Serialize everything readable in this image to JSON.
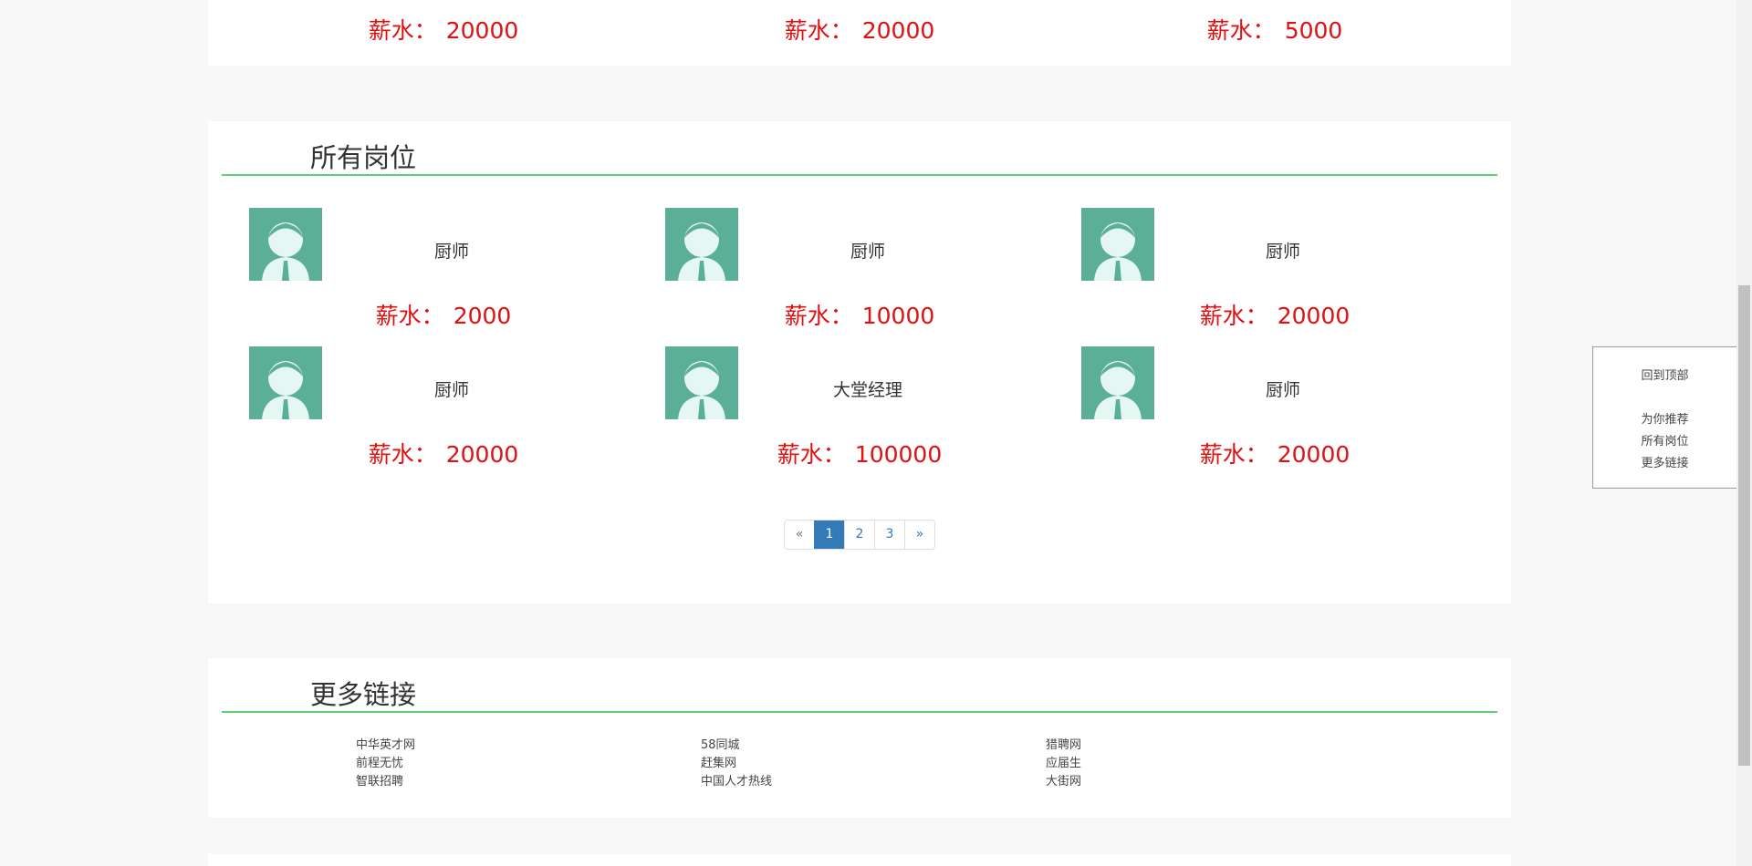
{
  "recommend": {
    "salary_label": "薪水：",
    "salaries": [
      "20000",
      "20000",
      "5000"
    ]
  },
  "all_jobs": {
    "title": "所有岗位",
    "salary_label": "薪水：",
    "jobs": [
      {
        "name": "厨师",
        "salary": "2000"
      },
      {
        "name": "厨师",
        "salary": "10000"
      },
      {
        "name": "厨师",
        "salary": "20000"
      },
      {
        "name": "厨师",
        "salary": "20000"
      },
      {
        "name": "大堂经理",
        "salary": "100000"
      },
      {
        "name": "厨师",
        "salary": "20000"
      }
    ],
    "avatar_icon": "person-avatar-icon",
    "pagination": {
      "prev": "«",
      "pages": [
        "1",
        "2",
        "3"
      ],
      "next": "»",
      "current": "1"
    }
  },
  "more_links": {
    "title": "更多链接",
    "columns": [
      [
        "中华英才网",
        "前程无忧",
        "智联招聘"
      ],
      [
        "58同城",
        "赶集网",
        "中国人才热线"
      ],
      [
        "猎聘网",
        "应届生",
        "大街网"
      ]
    ]
  },
  "side_nav": {
    "back_to_top": "回到顶部",
    "items": [
      "为你推荐",
      "所有岗位",
      "更多链接"
    ]
  },
  "colors": {
    "salary": "#e01010",
    "rule": "#5ccf6f",
    "avatar_bg": "#5aaf96",
    "pager_active": "#337ab7"
  }
}
